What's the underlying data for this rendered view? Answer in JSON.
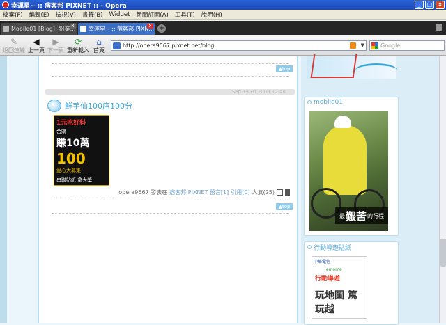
{
  "window": {
    "title": "幸運星~ :: 痞客邦 PIXNET :: - Opera"
  },
  "menu": [
    "檔案(F)",
    "編輯(E)",
    "檢視(V)",
    "書籤(B)",
    "Widget",
    "新聞訂閱(A)",
    "工具(T)",
    "說明(H)"
  ],
  "tabs": [
    {
      "label": "Mobile01 [Blog]--鋁業..."
    },
    {
      "label": "幸運星~ :: 痞客邦 PIXN..."
    }
  ],
  "toolbar": {
    "back_list": "返回連線",
    "back": "上一頁",
    "forward": "下一頁",
    "reload": "重新載入",
    "home": "首頁"
  },
  "address": {
    "url": "http://opera9567.pixnet.net/blog"
  },
  "search": {
    "placeholder": "Google"
  },
  "blog": {
    "top_label": "▲top",
    "post_date": "Sep 19 Fri 2008 12:48",
    "post_title": "鮮芋仙100店100分",
    "ad": {
      "l1": "1元吃好料",
      "l2": "合購",
      "l3": "賺10萬",
      "l4": "100",
      "l5": "愛心大募集",
      "l6": "串聯貼紙 拿大獎"
    },
    "meta": {
      "author": "opera9567 發表在",
      "blog": "痞客邦 PIXNET 留言[1]",
      "ref": "引用[0]",
      "views": "人氣(25)"
    }
  },
  "sidebar": {
    "panel1_title": "mobile01",
    "caption_pre": "最",
    "caption_big": "艱苦",
    "caption_post": "的行程",
    "panel2_title": "行動導遊貼紙",
    "m_brand": "中華電信",
    "m_line": "emome",
    "m_title": "行動導遊",
    "m_bottom": "玩地圖 篤玩越"
  },
  "colors": {
    "accent": "#3ba8de",
    "tab_active": "#3d6fc4",
    "titlebar": "#1a47b8"
  }
}
